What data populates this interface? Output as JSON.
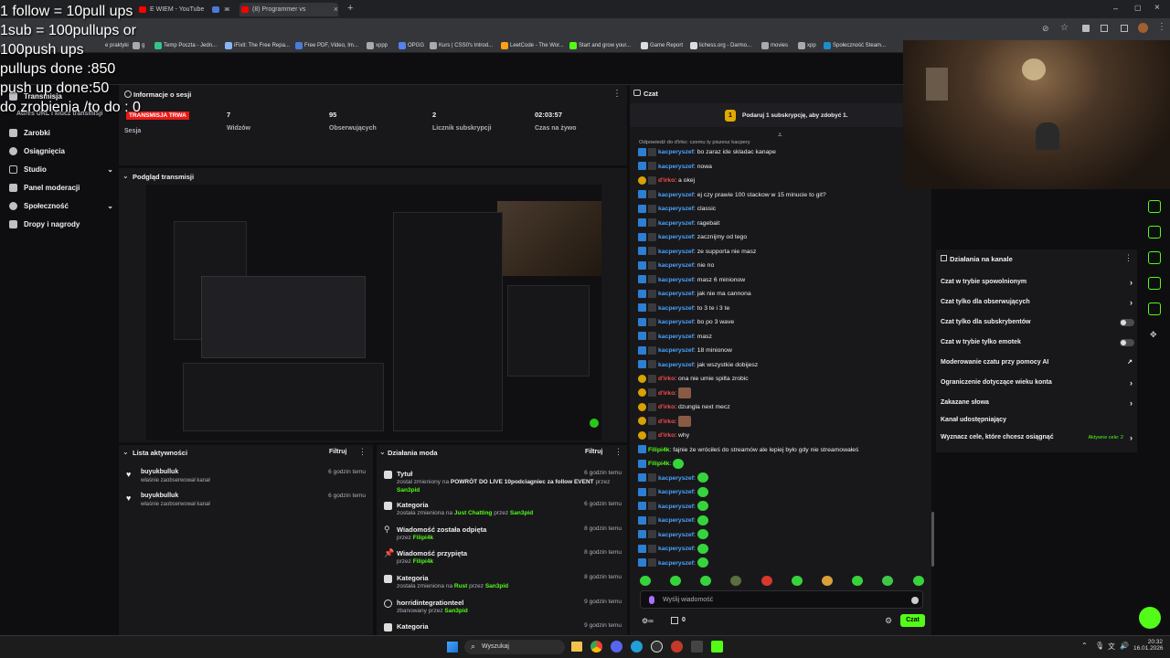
{
  "browser": {
    "tabs": [
      {
        "label": "E WIEM - YouTube",
        "color": "#ff0000"
      },
      {
        "label": "",
        "color": "#4a7bd8"
      },
      {
        "label": "(8) Programmer vs Runescape",
        "color": "#ff0000"
      }
    ],
    "bookmarks": [
      "e praktyki",
      "g",
      "Temp Poczta - Jedn...",
      "iFixit: The Free Repa...",
      "Free PDF, Video, Im...",
      "xppp",
      "OPGG",
      "Kurs | CSS0's Introd...",
      "LeetCode - The Wor...",
      "Start and grow your...",
      "Game Report",
      "lichess.org - Darmo...",
      "movies",
      "xpp",
      "Społeczność Steam..."
    ]
  },
  "overlay": {
    "lines": [
      "1 follow = 10pull ups",
      "1sub = 100pullups or",
      "100push ups",
      "pullups done :850",
      "push up done:50",
      "do zrobienia /to do : 0"
    ]
  },
  "sidebar": {
    "stream_key": "Adres URL i klucz transmisji",
    "items": [
      {
        "label": "Transmisja",
        "chev": ""
      },
      {
        "label": "Zarobki",
        "chev": ""
      },
      {
        "label": "Osiągnięcia",
        "chev": ""
      },
      {
        "label": "Studio",
        "chev": "⌄"
      },
      {
        "label": "Panel moderacji",
        "chev": ""
      },
      {
        "label": "Społeczność",
        "chev": "⌄"
      },
      {
        "label": "Dropy i nagrody",
        "chev": ""
      }
    ]
  },
  "session": {
    "title": "Informacje o sesji",
    "badge": "TRANSMISJA TRWA",
    "badge_label": "Sesja",
    "stats": [
      {
        "value": "7",
        "label": "Widzów"
      },
      {
        "value": "95",
        "label": "Obserwujących"
      },
      {
        "value": "2",
        "label": "Licznik subskrypcji"
      },
      {
        "value": "02:03:57",
        "label": "Czas na żywo"
      }
    ]
  },
  "preview": {
    "title": "Podgląd transmisji"
  },
  "activity": {
    "title": "Lista aktywności",
    "filter": "Filtruj",
    "items": [
      {
        "user": "buyukbulluk",
        "desc": "właśnie zaobserwował kanał",
        "time": "6 godzin temu"
      },
      {
        "user": "buyukbulluk",
        "desc": "właśnie zaobserwował kanał",
        "time": "6 godzin temu"
      }
    ]
  },
  "mod": {
    "title": "Działania moda",
    "filter": "Filtruj",
    "items": [
      {
        "title": "Tytuł",
        "d1": "został zmieniony na ",
        "hl": "POWRÓT DO LIVE 10podciagniec za follow EVENT",
        "d2": " przez",
        "by": "San3pid",
        "time": "6 godzin temu"
      },
      {
        "title": "Kategoria",
        "d1": "została zmieniona na ",
        "hl": "Just Chatting",
        "d2": " przez ",
        "by": "San3pid",
        "time": "6 godzin temu"
      },
      {
        "title": "Wiadomość została odpięta",
        "d1": "przez ",
        "hl": "",
        "d2": "",
        "by": "Filipi4k",
        "time": "8 godzin temu"
      },
      {
        "title": "Wiadomość przypięta",
        "d1": "przez ",
        "hl": "",
        "d2": "",
        "by": "Filipi4k",
        "time": "8 godzin temu"
      },
      {
        "title": "Kategoria",
        "d1": "została zmieniona na ",
        "hl": "Rust",
        "d2": " przez ",
        "by": "San3pid",
        "time": "8 godzin temu"
      },
      {
        "title": "horridintegrationteel",
        "d1": "zbanowany przez ",
        "hl": "",
        "d2": "",
        "by": "San3pid",
        "time": "9 godzin temu"
      },
      {
        "title": "Kategoria",
        "d1": "",
        "hl": "",
        "d2": "",
        "by": "",
        "time": "9 godzin temu"
      }
    ]
  },
  "chat": {
    "title": "Czat",
    "promo": "Podaruj 1 subskrypcję, aby zdobyć 1.",
    "reply_hint": "Odpowiedź do d'irko: czemu ty piszesz kacpery",
    "messages": [
      {
        "user": "kacperyszef",
        "text": "bo zaraz ide skladac kanape",
        "color": "#4aa3ff"
      },
      {
        "user": "kacperyszef",
        "text": "nowa",
        "color": "#4aa3ff"
      },
      {
        "user": "d'irko",
        "text": "a okej",
        "color": "#ff4a4a"
      },
      {
        "user": "kacperyszef",
        "text": "ej czy prawie 100 stackow w 15 minucie to git?",
        "color": "#4aa3ff"
      },
      {
        "user": "kacperyszef",
        "text": "classic",
        "color": "#4aa3ff"
      },
      {
        "user": "kacperyszef",
        "text": "ragebait",
        "color": "#4aa3ff"
      },
      {
        "user": "kacperyszef",
        "text": "zacznijmy od tego",
        "color": "#4aa3ff"
      },
      {
        "user": "kacperyszef",
        "text": "ze supporta nie masz",
        "color": "#4aa3ff"
      },
      {
        "user": "kacperyszef",
        "text": "nie no",
        "color": "#4aa3ff"
      },
      {
        "user": "kacperyszef",
        "text": "masz 6 minionow",
        "color": "#4aa3ff"
      },
      {
        "user": "kacperyszef",
        "text": "jak nie ma cannona",
        "color": "#4aa3ff"
      },
      {
        "user": "kacperyszef",
        "text": "to 3 te i 3 te",
        "color": "#4aa3ff"
      },
      {
        "user": "kacperyszef",
        "text": "bo po 3 wave",
        "color": "#4aa3ff"
      },
      {
        "user": "kacperyszef",
        "text": "masz",
        "color": "#4aa3ff"
      },
      {
        "user": "kacperyszef",
        "text": "18 minionow",
        "color": "#4aa3ff"
      },
      {
        "user": "kacperyszef",
        "text": "jak wszystkie dobijesz",
        "color": "#4aa3ff"
      },
      {
        "user": "d'irko",
        "text": "ona nie umie spilta zrobic",
        "color": "#ff4a4a"
      },
      {
        "user": "d'irko",
        "text": "",
        "color": "#ff4a4a"
      },
      {
        "user": "d'irko",
        "text": "dzungla next mecz",
        "color": "#ff4a4a"
      },
      {
        "user": "d'irko",
        "text": "",
        "color": "#ff4a4a"
      },
      {
        "user": "d'irko",
        "text": "why",
        "color": "#ff4a4a"
      },
      {
        "user": "Filipi4k",
        "text": "fajnie że wróciłeś do streamów ale lepiej było gdy nie streamowałeś",
        "color": "#53fc18"
      },
      {
        "user": "Filipi4k",
        "text": "",
        "color": "#53fc18"
      },
      {
        "user": "kacperyszef",
        "text": "",
        "color": "#4aa3ff"
      },
      {
        "user": "kacperyszef",
        "text": "",
        "color": "#4aa3ff"
      },
      {
        "user": "kacperyszef",
        "text": "",
        "color": "#4aa3ff"
      },
      {
        "user": "kacperyszef",
        "text": "",
        "color": "#4aa3ff"
      },
      {
        "user": "kacperyszef",
        "text": "",
        "color": "#4aa3ff"
      },
      {
        "user": "kacperyszef",
        "text": "",
        "color": "#4aa3ff"
      },
      {
        "user": "kacperyszef",
        "text": "",
        "color": "#4aa3ff"
      }
    ],
    "placeholder": "Wyślij wiadomość",
    "send": "Czat",
    "points": "0"
  },
  "channel": {
    "title": "Działania na kanale",
    "items": [
      {
        "label": "Czat w trybie spowolnionym",
        "ctrl": "arrow"
      },
      {
        "label": "Czat tylko dla obserwujących",
        "ctrl": "arrow"
      },
      {
        "label": "Czat tylko dla subskrybentów",
        "ctrl": "toggle"
      },
      {
        "label": "Czat w trybie tylko emotek",
        "ctrl": "toggle"
      },
      {
        "label": "Moderowanie czatu przy pomocy AI",
        "ctrl": "ext"
      },
      {
        "label": "Ograniczenie dotyczące wieku konta",
        "ctrl": "arrow"
      },
      {
        "label": "Zakazane słowa",
        "ctrl": "arrow"
      },
      {
        "label": "Kanał udostępniający",
        "ctrl": ""
      },
      {
        "label": "Wyznacz cele, które chcesz osiągnąć",
        "ctrl": "arrow"
      }
    ],
    "goals_active": "Aktywne cele: 2"
  },
  "taskbar": {
    "search": "Wyszukaj",
    "time": "20:32",
    "date": "16.01.2026"
  }
}
